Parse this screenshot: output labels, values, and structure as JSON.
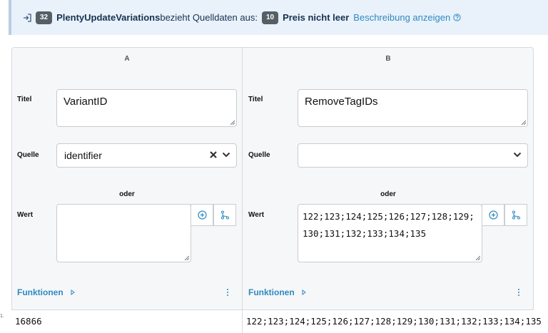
{
  "banner": {
    "left_badge": "32",
    "source_name": "PlentyUpdateVariations",
    "middle_text": "bezieht Quelldaten aus:",
    "right_badge": "10",
    "target_name": "Preis nicht leer",
    "link_text": "Beschreibung anzeigen"
  },
  "columns": [
    {
      "header": "A",
      "title_label": "Titel",
      "title_value": "VariantID",
      "source_label": "Quelle",
      "source_value": "identifier",
      "or_text": "oder",
      "value_label": "Wert",
      "value_text": "",
      "functions_label": "Funktionen",
      "result": "16866"
    },
    {
      "header": "B",
      "title_label": "Titel",
      "title_value": "RemoveTagIDs",
      "source_label": "Quelle",
      "source_value": "",
      "or_text": "oder",
      "value_label": "Wert",
      "value_text": "122;123;124;125;126;127;128;129;130;131;132;133;134;135",
      "functions_label": "Funktionen",
      "result": "122;123;124;125;126;127;128;129;130;131;132;133;134;135"
    }
  ],
  "row_number": "1.",
  "colors": {
    "link": "#2e8ac0",
    "badge": "#555f66",
    "banner_bg": "#e9f1fa"
  }
}
